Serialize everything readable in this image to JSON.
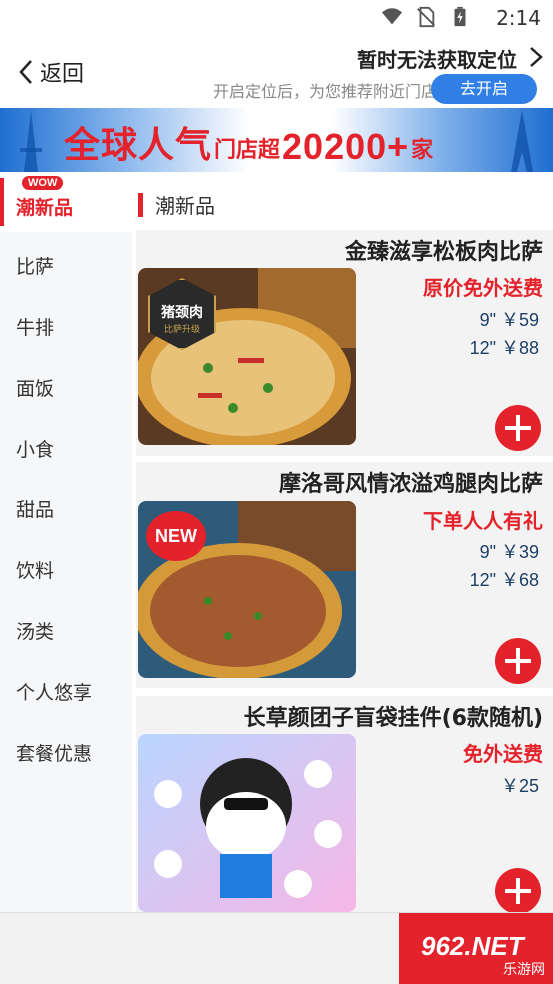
{
  "status_bar": {
    "time": "2:14"
  },
  "header": {
    "back_label": "返回",
    "location_title": "暂时无法获取定位",
    "location_subtitle": "开启定位后，为您推荐附近门店",
    "open_button": "去开启"
  },
  "banner": {
    "part1": "全球人气",
    "part2": "门店超",
    "part3": "20200+",
    "part4": "家"
  },
  "sidebar": {
    "items": [
      {
        "label": "潮新品",
        "badge": "WOW"
      },
      {
        "label": "比萨"
      },
      {
        "label": "牛排"
      },
      {
        "label": "面饭"
      },
      {
        "label": "小食"
      },
      {
        "label": "甜品"
      },
      {
        "label": "饮料"
      },
      {
        "label": "汤类"
      },
      {
        "label": "个人悠享"
      },
      {
        "label": "套餐优惠"
      }
    ]
  },
  "section": {
    "title": "潮新品"
  },
  "products": [
    {
      "title": "金臻滋享松板肉比萨",
      "promo": "原价免外送费",
      "prices": [
        "9\" ￥59",
        "12\" ￥88"
      ],
      "badge_main": "猪颈肉",
      "badge_sub": "比萨升级"
    },
    {
      "title": "摩洛哥风情浓溢鸡腿肉比萨",
      "promo": "下单人人有礼",
      "prices": [
        "9\" ￥39",
        "12\" ￥68"
      ],
      "badge": "NEW"
    },
    {
      "title": "长草颜团子盲袋挂件(6款随机)",
      "promo": "免外送费",
      "prices": [
        "￥25"
      ]
    }
  ],
  "watermark": {
    "text1": "962.NET",
    "text2": "乐游网"
  },
  "colors": {
    "brand_red": "#e3222b",
    "accent_blue": "#2f7fe4",
    "price_navy": "#1e3f66"
  }
}
